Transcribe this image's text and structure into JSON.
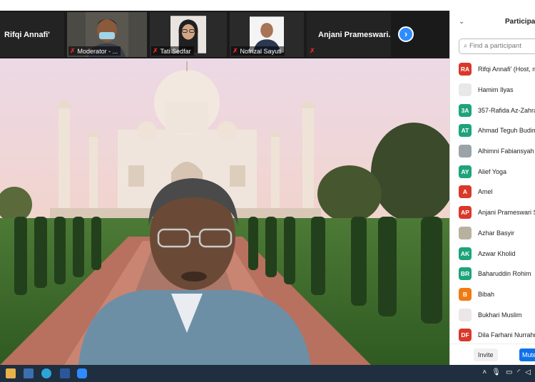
{
  "gallery": {
    "tiles": [
      {
        "name": "Rifqi Annafi'",
        "label": ""
      },
      {
        "name": "",
        "label": "Moderator - ..."
      },
      {
        "name": "",
        "label": "Tati Sedfar"
      },
      {
        "name": "",
        "label": "Nofrizal Sayuti"
      },
      {
        "name": "Anjani  Prameswari...",
        "label": ""
      }
    ],
    "next_icon": "chevron-right-icon"
  },
  "panel": {
    "title": "Participants",
    "search_placeholder": "Find a participant",
    "participants": [
      {
        "initials": "RA",
        "name": "Rifqi Annafi' (Host, me)",
        "color": "#d9382a"
      },
      {
        "initials": "",
        "name": "Hamim Ilyas",
        "color": "#e8e8e8"
      },
      {
        "initials": "3A",
        "name": "357-Rafida Az-Zahra",
        "color": "#1ea37a"
      },
      {
        "initials": "AT",
        "name": "Ahmad Teguh Budiman",
        "color": "#1ea37a"
      },
      {
        "initials": "",
        "name": "Alhimni Fabiansyah",
        "color": "#9aa3aa"
      },
      {
        "initials": "AY",
        "name": "Alief Yoga",
        "color": "#1ea37a"
      },
      {
        "initials": "A",
        "name": "Amel",
        "color": "#d9382a"
      },
      {
        "initials": "AP",
        "name": "Anjani Prameswari S.",
        "color": "#d9382a"
      },
      {
        "initials": "",
        "name": "Azhar Basyir",
        "color": "#b9b1a0"
      },
      {
        "initials": "AK",
        "name": "Azwar Kholid",
        "color": "#1ea37a"
      },
      {
        "initials": "BR",
        "name": "Baharuddin Rohim",
        "color": "#1ea37a"
      },
      {
        "initials": "B",
        "name": "Bibah",
        "color": "#f07a14"
      },
      {
        "initials": "",
        "name": "Bukhari Muslim",
        "color": "#ece6e6"
      },
      {
        "initials": "DF",
        "name": "Dila Farhani Nurrahmi",
        "color": "#d9382a"
      }
    ],
    "invite_label": "Invite",
    "mute_all_label": "Mute All"
  }
}
